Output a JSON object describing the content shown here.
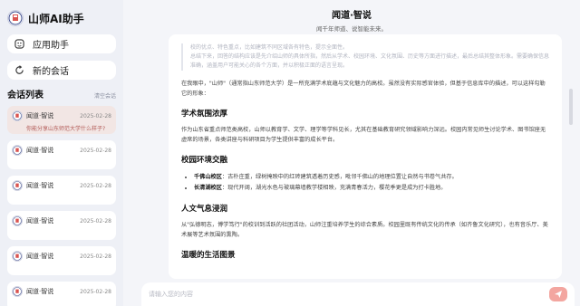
{
  "app": {
    "name": "山师AI助手",
    "accent": "#d9534f"
  },
  "sidebar": {
    "buttons": [
      {
        "label": "应用助手",
        "icon": "grid-icon"
      },
      {
        "label": "新的会话",
        "icon": "chat-refresh-icon"
      }
    ],
    "list_title": "会话列表",
    "clear_label": "清空会话",
    "conversations": [
      {
        "name": "闻道·智说",
        "date": "2025-02-28",
        "preview": "你能分享山东师范大学什么样子?",
        "active": true
      },
      {
        "name": "闻道·智说",
        "date": "2025-02-28",
        "preview": ""
      },
      {
        "name": "闻道·智说",
        "date": "2025-02-28",
        "preview": ""
      },
      {
        "name": "闻道·智说",
        "date": "2025-02-28",
        "preview": ""
      },
      {
        "name": "闻道·智说",
        "date": "2025-02-28",
        "preview": ""
      },
      {
        "name": "闻道·智说",
        "date": "2025-02-28",
        "preview": ""
      }
    ]
  },
  "header": {
    "title": "闻道·智说",
    "subtitle": "闻千年师道、说智能未来。"
  },
  "message": {
    "quote_1": "校的优点、特色重点，比如建筑不同区域各有特色，提示全面性。",
    "quote_2": "总结下来，回答的结构应该是先介绍山师的具体所指，然后从学术、校园环境、文化氛围、历史等方面进行描述，最后总结其整体形象。需要确保信息准确，涵盖用户可能关心的各个方面，并以积极正面的语言呈现。",
    "intro": "在我眼中，\"山师\"（通常指山东师范大学）是一所充满学术底蕴与文化魅力的高校。虽然没有实际感官体验，但基于信息库中的描述，可以这样勾勒它的形象：",
    "sections": [
      {
        "heading": "学术氛围浓厚",
        "text": "作为山东省重点师范类高校，山师以教育学、文学、理学等学科见长，尤其在基础教育研究领域影响力深远。校园内常见师生讨论学术、图书馆座无虚席的场景，各类讲座与科研项目为学生提供丰富的成长平台。"
      },
      {
        "heading": "校园环境交融",
        "items": [
          {
            "bold": "千佛山校区",
            "text": "：古朴庄重，绿树掩映中的红砖建筑透着历史感，毗邻千佛山的地理位置让自然与书卷气共存。"
          },
          {
            "bold": "长清湖校区",
            "text": "：现代开阔，湖光水色与玻璃幕墙教学楼相映，充满青春活力，樱花季更是成为打卡胜地。"
          }
        ]
      },
      {
        "heading": "人文气息浸润",
        "text": "从\"弘德明志，博学笃行\"的校训到活跃的社团活动，山师注重培养学生的综合素质。校园里既有传统文化的传承（如齐鲁文化研究），也有音乐厅、美术展等艺术氛围的熏陶。"
      },
      {
        "heading": "温暖的生活图景",
        "text": ""
      }
    ]
  },
  "input": {
    "placeholder": "请输入您的内容"
  }
}
